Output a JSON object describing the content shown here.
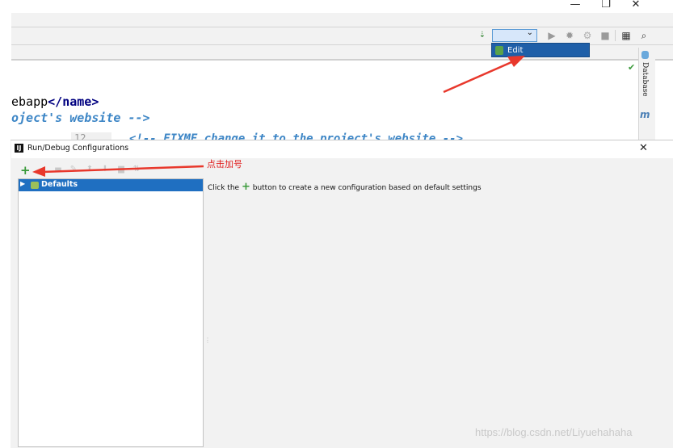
{
  "window": {
    "minimize_glyph": "—",
    "restore_glyph": "❐",
    "close_glyph": "✕"
  },
  "toolbar": {
    "edit_configurations_label": "Edit Configurations..."
  },
  "editor": {
    "line1_prefix": "ebapp",
    "line1_tag": "</name>",
    "line2": "oject's website -->",
    "line3_gutter": "12",
    "line3": "<!-- FIXME change it to the project's website -->"
  },
  "right_strip": {
    "database_label": "Database",
    "maven_glyph": "m"
  },
  "dialog": {
    "title": "Run/Debug Configurations",
    "app_icon_letter": "IJ",
    "close_glyph": "✕",
    "add_glyph": "+",
    "tree": {
      "items": [
        {
          "label": "Defaults",
          "selected": true
        }
      ]
    },
    "hint_before": "Click the",
    "hint_plus": "+",
    "hint_after": "button to create a new configuration based on default settings"
  },
  "annotations": {
    "click_plus_text": "点击加号",
    "arrow_color": "#e8382c"
  },
  "watermark": "https://blog.csdn.net/Liyuehahaha",
  "colors": {
    "selection_blue": "#1f6fc1",
    "popup_blue": "#1f5fa8",
    "add_green": "#3a9a3a",
    "annotation_red": "#e02020"
  }
}
